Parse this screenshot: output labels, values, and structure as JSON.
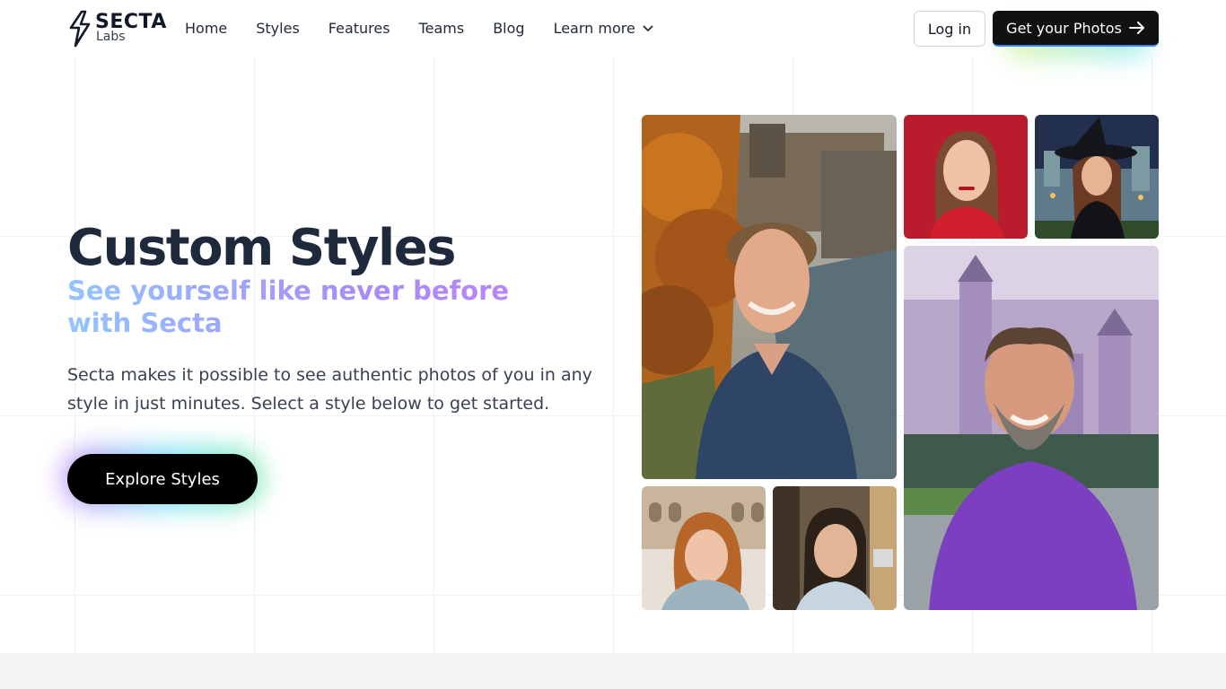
{
  "brand": {
    "name": "SECTA",
    "sub": "Labs",
    "logo_icon": "lightning-bolt-icon"
  },
  "nav": {
    "items": [
      {
        "label": "Home"
      },
      {
        "label": "Styles"
      },
      {
        "label": "Features"
      },
      {
        "label": "Teams"
      },
      {
        "label": "Blog"
      }
    ],
    "learn_more": "Learn more",
    "learn_more_icon": "chevron-down-icon"
  },
  "header_actions": {
    "login": "Log in",
    "get_photos": "Get your Photos",
    "get_photos_icon": "arrow-right-icon"
  },
  "hero": {
    "title": "Custom Styles",
    "subtitle": "See yourself like never before with Secta",
    "description": "Secta makes it possible to see authentic photos of you in any style in just minutes. Select a style below to get started.",
    "cta": "Explore Styles"
  },
  "colors": {
    "title": "#1e293b",
    "gradient_start": "#93c5fd",
    "gradient_end": "#c084fc",
    "button_dark": "#000000"
  },
  "photos": [
    {
      "subject": "man in blue shirt, autumn city river background"
    },
    {
      "subject": "woman on red background"
    },
    {
      "subject": "woman in witch hat before castle at night"
    },
    {
      "subject": "bearded man in purple sweater before castle"
    },
    {
      "subject": "curly haired woman before colosseum"
    },
    {
      "subject": "dark haired woman on city street"
    }
  ]
}
